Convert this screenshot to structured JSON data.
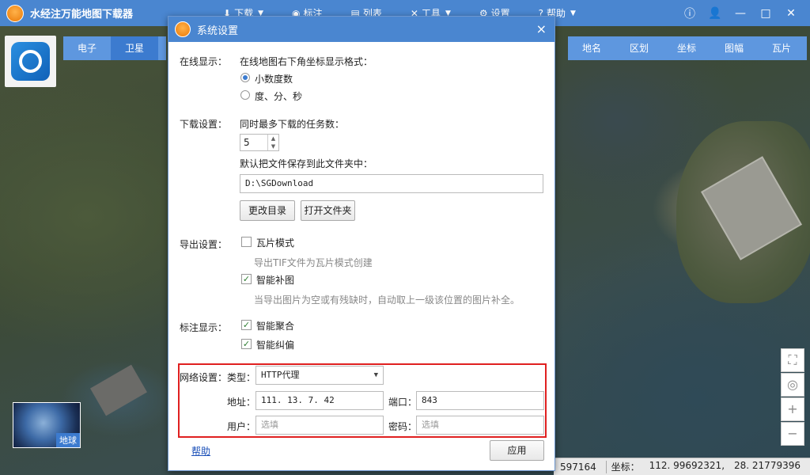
{
  "app": {
    "title": "水经注万能地图下载器"
  },
  "top_menu": [
    {
      "icon": "download-icon",
      "glyph": "⬇",
      "label": "下载",
      "caret": true
    },
    {
      "icon": "mark-icon",
      "glyph": "◉",
      "label": "标注",
      "caret": false
    },
    {
      "icon": "list-icon",
      "glyph": "▤",
      "label": "列表",
      "caret": false
    },
    {
      "icon": "tools-icon",
      "glyph": "✕",
      "label": "工具",
      "caret": true
    },
    {
      "icon": "settings-icon",
      "glyph": "⚙",
      "label": "设置",
      "caret": false
    },
    {
      "icon": "help-icon",
      "glyph": "?",
      "label": "帮助",
      "caret": true
    }
  ],
  "window_controls": {
    "info": "ⓘ",
    "user": "👤",
    "min": "—",
    "max": "□",
    "close": "✕"
  },
  "map_types": {
    "electronic": "电子",
    "satellite": "卫星"
  },
  "right_tools": [
    "地名",
    "区划",
    "坐标",
    "图幅",
    "瓦片"
  ],
  "zoom_controls": {
    "fit": "⛶",
    "locate": "◎",
    "zoom_in": "+",
    "zoom_out": "−"
  },
  "globe": {
    "label": "地球"
  },
  "status": {
    "cell1": "597164",
    "coord_label": "坐标：",
    "lon": "112. 99692321,",
    "lat": "28. 21779396"
  },
  "dialog": {
    "title": "系统设置",
    "close": "×",
    "online_display": {
      "section": "在线显示：",
      "desc": "在线地图右下角坐标显示格式：",
      "options": [
        {
          "label": "小数度数",
          "selected": true
        },
        {
          "label": "度、分、秒",
          "selected": false
        }
      ]
    },
    "download": {
      "section": "下载设置：",
      "max_tasks_label": "同时最多下载的任务数：",
      "max_tasks_value": "5",
      "save_dir_label": "默认把文件保存到此文件夹中：",
      "save_dir_value": "D:\\SGDownload",
      "change_dir_button": "更改目录",
      "open_folder_button": "打开文件夹"
    },
    "export": {
      "section": "导出设置：",
      "tile_mode": {
        "label": "瓦片模式",
        "checked": false
      },
      "tile_mode_hint": "导出TIF文件为瓦片模式创建",
      "smart_fill": {
        "label": "智能补图",
        "checked": true
      },
      "smart_fill_hint": "当导出图片为空或有残缺时，自动取上一级该位置的图片补全。"
    },
    "label_display": {
      "section": "标注显示：",
      "smart_merge": {
        "label": "智能聚合",
        "checked": true
      },
      "smart_correct": {
        "label": "智能纠偏",
        "checked": true
      }
    },
    "network": {
      "section": "网络设置：",
      "type_label": "类型：",
      "type_value": "HTTP代理",
      "address_label": "地址：",
      "address_value": "111. 13. 7. 42",
      "port_label": "端口：",
      "port_value": "843",
      "user_label": "用户：",
      "user_placeholder": "选填",
      "password_label": "密码：",
      "password_placeholder": "选填"
    },
    "help_link": "帮助",
    "apply_button": "应用"
  },
  "colors": {
    "titlebar": "#4a86d0",
    "accent": "#3c7bcf",
    "highlight_box": "#e02020"
  }
}
